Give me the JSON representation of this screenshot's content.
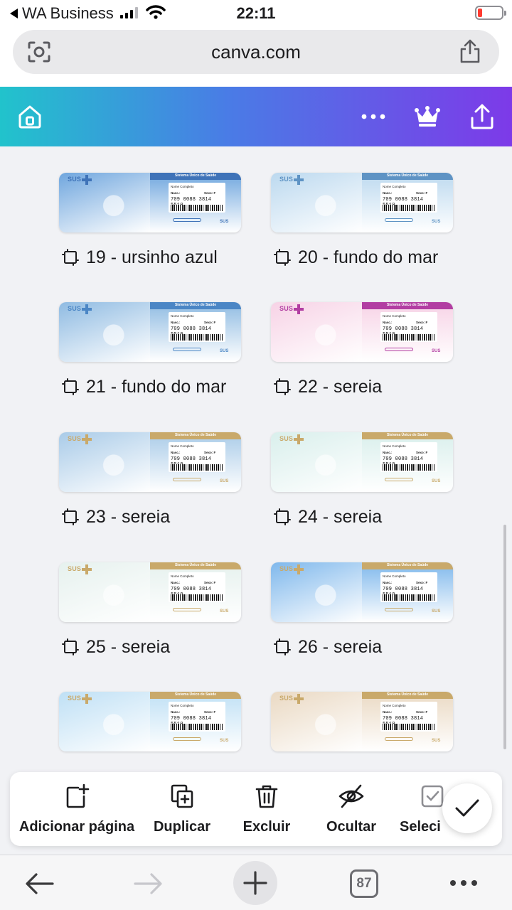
{
  "status_bar": {
    "back_app": "WA Business",
    "time": "22:11"
  },
  "url_bar": {
    "url": "canva.com",
    "icons": [
      "scan-icon",
      "share-icon"
    ]
  },
  "canva_header": {
    "icons": [
      "home-icon",
      "more-icon",
      "crown-icon",
      "upload-icon"
    ],
    "gradient": [
      "#21c3cc",
      "#4a7be6",
      "#7d3ae8"
    ]
  },
  "pages": [
    {
      "label": "19 - ursinho azul",
      "theme": "#6fa6de",
      "accent": "#3f73b8"
    },
    {
      "label": "20 - fundo do mar",
      "theme": "#bcd9ef",
      "accent": "#5e93c4"
    },
    {
      "label": "21 - fundo do mar",
      "theme": "#8fbbe2",
      "accent": "#4b86c5"
    },
    {
      "label": "22 - sereia",
      "theme": "#f7d3e6",
      "accent": "#b23ea2"
    },
    {
      "label": "23 - sereia",
      "theme": "#a9cbe8",
      "accent": "#c9a96a"
    },
    {
      "label": "24 - sereia",
      "theme": "#d9efec",
      "accent": "#c9a96a"
    },
    {
      "label": "25 - sereia",
      "theme": "#e6f1ee",
      "accent": "#c9a96a"
    },
    {
      "label": "26 - sereia",
      "theme": "#7fb8ec",
      "accent": "#c9a96a"
    },
    {
      "label": "",
      "theme": "#bfe0f5",
      "accent": "#c9a96a"
    },
    {
      "label": "",
      "theme": "#ead9c3",
      "accent": "#c9a96a"
    }
  ],
  "card_text": {
    "sus": "SUS",
    "sistema": "Sistema Único de Saúde",
    "nome": "Nome Completo",
    "nasc": "Nasc.:",
    "sexo": "Sexo: F",
    "numero": "709 0088 3814 5510"
  },
  "actions": {
    "add_page": "Adicionar página",
    "duplicate": "Duplicar",
    "delete": "Excluir",
    "hide": "Ocultar",
    "select": "Seleci"
  },
  "toolbar": {
    "tab_count": "87"
  }
}
